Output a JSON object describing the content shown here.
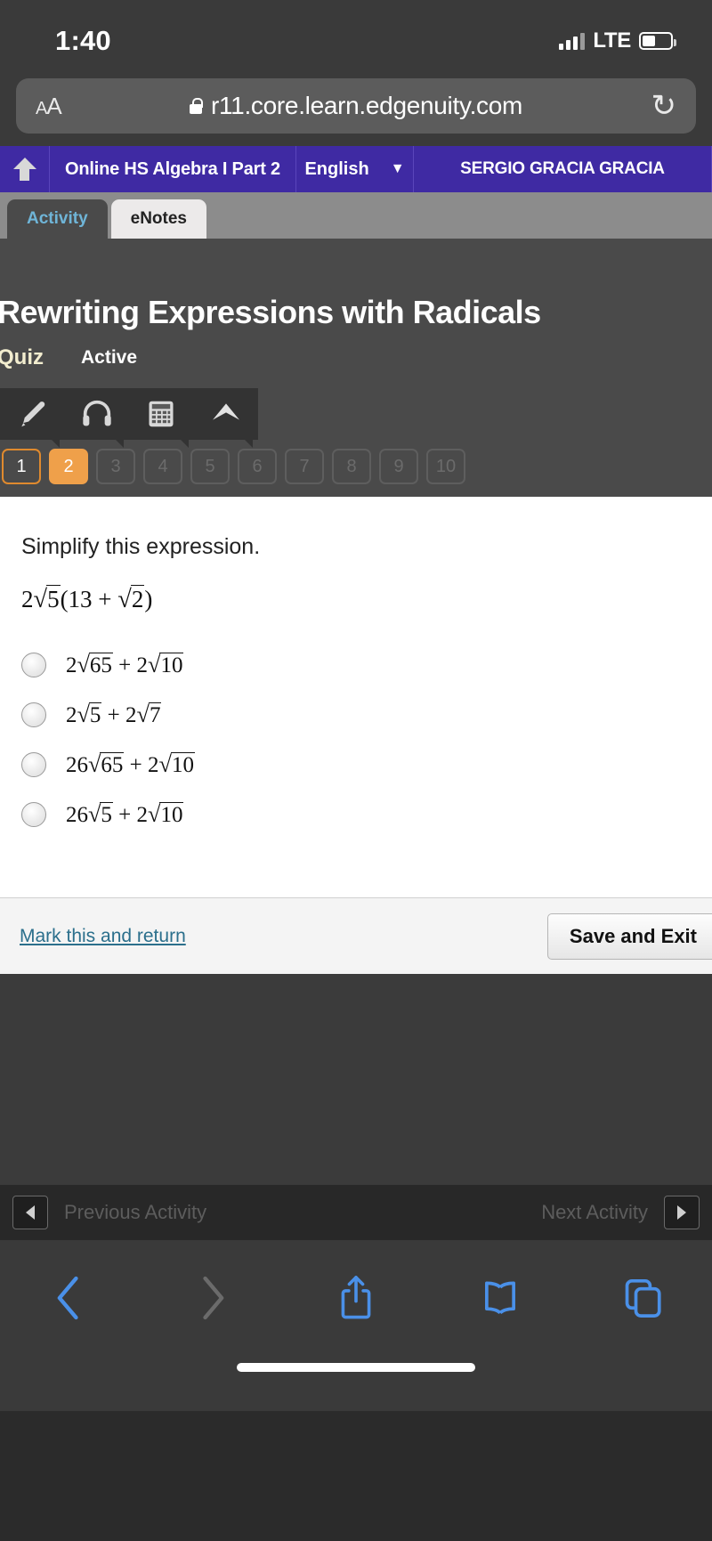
{
  "status_bar": {
    "time": "1:40",
    "network": "LTE",
    "signal_icon": "cellular-signal-icon",
    "battery_icon": "battery-icon"
  },
  "browser": {
    "aa_small": "A",
    "aa_large": "A",
    "lock_icon": "lock-icon",
    "url": "r11.core.learn.edgenuity.com",
    "reload_glyph": "↻",
    "reload_icon": "reload-icon"
  },
  "course_nav": {
    "home_icon": "home-icon",
    "course_title": "Online HS Algebra I Part 2",
    "language": "English",
    "language_chevron": "⌄",
    "user_name": "SERGIO GRACIA GRACIA"
  },
  "tabs": [
    {
      "label": "Activity",
      "active": true
    },
    {
      "label": "eNotes",
      "active": false
    }
  ],
  "activity": {
    "title": "Rewriting Expressions with Radicals",
    "kind": "Quiz",
    "state": "Active",
    "accent_orange": "#efa04a",
    "accent_purple": "#3f2aa3",
    "kind_color": "#f2edcf"
  },
  "tools": [
    {
      "name": "highlighter-icon"
    },
    {
      "name": "headphones-icon"
    },
    {
      "name": "calculator-icon"
    },
    {
      "name": "reference-arrow-icon"
    }
  ],
  "question_nav": [
    {
      "label": "1",
      "state": "done"
    },
    {
      "label": "2",
      "state": "current"
    },
    {
      "label": "3",
      "state": "future"
    },
    {
      "label": "4",
      "state": "future"
    },
    {
      "label": "5",
      "state": "future"
    },
    {
      "label": "6",
      "state": "future"
    },
    {
      "label": "7",
      "state": "future"
    },
    {
      "label": "8",
      "state": "future"
    },
    {
      "label": "9",
      "state": "future"
    },
    {
      "label": "10",
      "state": "future"
    }
  ],
  "question": {
    "prompt": "Simplify this expression.",
    "expression": "2√5 (13 + √2)",
    "expression_parts": {
      "coef": "2",
      "radicand": "5",
      "open": "(13 + ",
      "inner_radicand": "2",
      "close": ")"
    },
    "options": [
      {
        "id": "a",
        "text": "2√65 + 2√10",
        "selected": false,
        "parts": {
          "c1": "2",
          "r1": "65",
          "op": " + ",
          "c2": "2",
          "r2": "10"
        }
      },
      {
        "id": "b",
        "text": "2√5 + 2√7",
        "selected": false,
        "parts": {
          "c1": "2",
          "r1": "5",
          "op": " + ",
          "c2": "2",
          "r2": "7"
        }
      },
      {
        "id": "c",
        "text": "26√65 + 2√10",
        "selected": false,
        "parts": {
          "c1": "26",
          "r1": "65",
          "op": " + ",
          "c2": "2",
          "r2": "10"
        }
      },
      {
        "id": "d",
        "text": "26√5 + 2√10",
        "selected": false,
        "parts": {
          "c1": "26",
          "r1": "5",
          "op": " + ",
          "c2": "2",
          "r2": "10"
        }
      }
    ]
  },
  "footer": {
    "mark_link": "Mark this and return",
    "save_button": "Save and Exit"
  },
  "activity_nav": {
    "previous_label": "Previous Activity",
    "next_label": "Next Activity",
    "prev_icon": "triangle-left-icon",
    "next_icon": "triangle-right-icon"
  },
  "safari_toolbar": [
    {
      "name": "back-icon",
      "enabled": true
    },
    {
      "name": "forward-icon",
      "enabled": false
    },
    {
      "name": "share-icon",
      "enabled": true
    },
    {
      "name": "bookmarks-icon",
      "enabled": true
    },
    {
      "name": "tabs-icon",
      "enabled": true
    }
  ]
}
